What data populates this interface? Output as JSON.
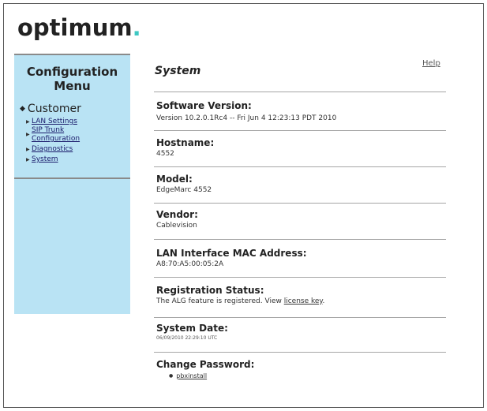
{
  "brand": {
    "logo_text": "optimum",
    "logo_dot": ".",
    "accent": "#3ec8c3"
  },
  "sidebar": {
    "title_line1": "Configuration",
    "title_line2": "Menu",
    "section_label": "Customer",
    "items": [
      {
        "label": "LAN Settings"
      },
      {
        "label_line1": "SIP Trunk",
        "label_line2": "Configuration"
      },
      {
        "label": "Diagnostics"
      },
      {
        "label": "System"
      }
    ],
    "background": "#b9e3f4"
  },
  "page": {
    "title": "System",
    "help_label": "Help"
  },
  "fields": {
    "software_version": {
      "label": "Software Version:",
      "value": "Version 10.2.0.1Rc4 -- Fri Jun 4 12:23:13 PDT 2010"
    },
    "hostname": {
      "label": "Hostname:",
      "value": "4552"
    },
    "model": {
      "label": "Model:",
      "value": "EdgeMarc 4552"
    },
    "vendor": {
      "label": "Vendor:",
      "value": "Cablevision"
    },
    "mac": {
      "label": "LAN Interface MAC Address:",
      "value": "A8:70:A5:00:05:2A"
    },
    "registration": {
      "label": "Registration Status:",
      "value_prefix": "The ALG feature is registered. View ",
      "link_text": "license key",
      "value_suffix": "."
    },
    "system_date": {
      "label": "System Date:",
      "value": "06/09/2010 22:29:10 UTC"
    },
    "change_password": {
      "label": "Change Password:",
      "item": "pbxinstall"
    }
  }
}
